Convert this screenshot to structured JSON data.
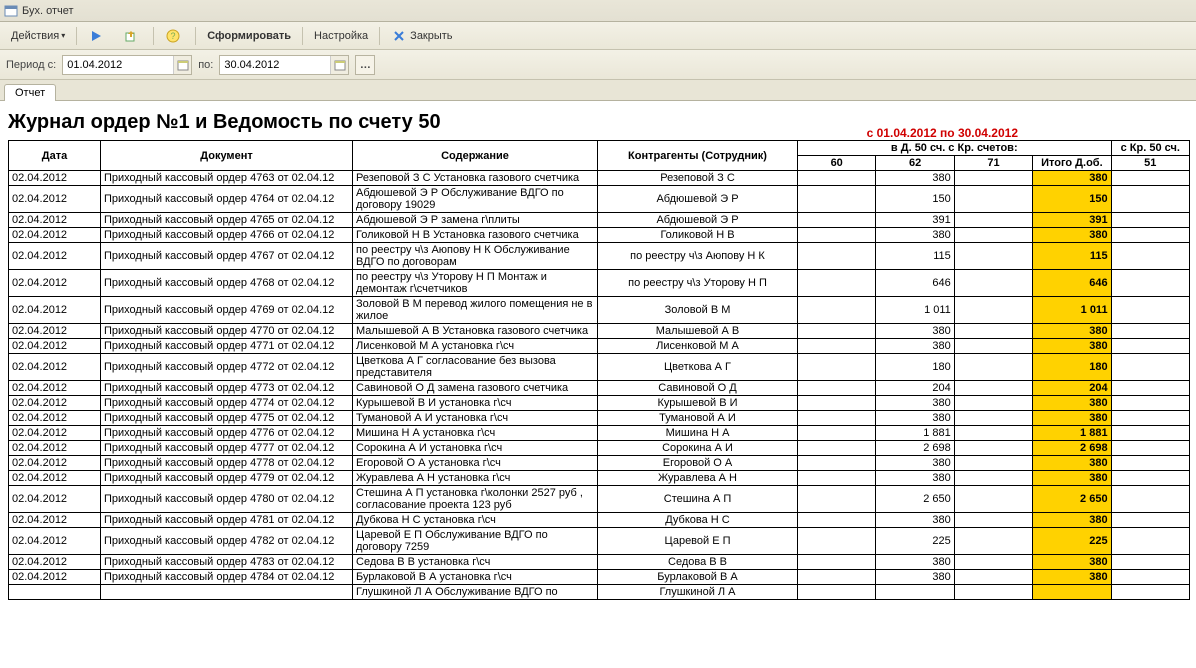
{
  "window": {
    "title": "Бух. отчет"
  },
  "toolbar": {
    "actions": "Действия",
    "form": "Сформировать",
    "settings": "Настройка",
    "close": "Закрыть"
  },
  "period": {
    "label_from": "Период с:",
    "from": "01.04.2012",
    "label_to": "по:",
    "to": "30.04.2012"
  },
  "tab": {
    "name": "Отчет"
  },
  "report": {
    "title": "Журнал ордер №1 и Ведомость по счету 50",
    "period_text": "с 01.04.2012 по 30.04.2012",
    "group_d": "в Д. 50 сч. с Кр. счетов:",
    "group_k": "с Кр. 50 сч.",
    "cols": {
      "date": "Дата",
      "doc": "Документ",
      "desc": "Содержание",
      "contr": "Контрагенты (Сотрудник)",
      "c60": "60",
      "c62": "62",
      "c71": "71",
      "total": "Итого Д.об.",
      "c51": "51"
    }
  },
  "rows": [
    {
      "date": "02.04.2012",
      "doc": "Приходный кассовый ордер 4763 от 02.04.12",
      "desc": "Резеповой З С    Установка газового счетчика",
      "contr": "Резеповой З С",
      "c62": "380",
      "total": "380"
    },
    {
      "date": "02.04.2012",
      "doc": "Приходный кассовый ордер 4764 от 02.04.12",
      "desc": "Абдюшевой  Э Р  Обслуживание ВДГО по договору 19029",
      "contr": "Абдюшевой  Э Р",
      "c62": "150",
      "total": "150"
    },
    {
      "date": "02.04.2012",
      "doc": "Приходный кассовый ордер 4765 от 02.04.12",
      "desc": "Абдюшевой  Э Р      замена г\\плиты",
      "contr": "Абдюшевой  Э Р",
      "c62": "391",
      "total": "391"
    },
    {
      "date": "02.04.2012",
      "doc": "Приходный кассовый ордер 4766 от 02.04.12",
      "desc": "Голиковой Н В     Установка газового счетчика",
      "contr": "Голиковой Н В",
      "c62": "380",
      "total": "380"
    },
    {
      "date": "02.04.2012",
      "doc": "Приходный кассовый ордер 4767 от 02.04.12",
      "desc": "по реестру ч\\з  Аюпову Н К   Обслуживание ВДГО по договорам",
      "contr": "по реестру ч\\з Аюпову Н К",
      "c62": "115",
      "total": "115"
    },
    {
      "date": "02.04.2012",
      "doc": "Приходный кассовый ордер 4768 от 02.04.12",
      "desc": "по реестру ч\\з Уторову Н П  Монтаж и демонтаж г\\счетчиков",
      "contr": "по реестру ч\\з Уторову Н П",
      "c62": "646",
      "total": "646"
    },
    {
      "date": "02.04.2012",
      "doc": "Приходный кассовый ордер 4769 от 02.04.12",
      "desc": "Золовой В М   перевод жилого помещения не в жилое",
      "contr": "Золовой В М",
      "c62": "1 011",
      "total": "1 011"
    },
    {
      "date": "02.04.2012",
      "doc": "Приходный кассовый ордер 4770 от 02.04.12",
      "desc": "Малышевой А В     Установка газового счетчика",
      "contr": "Малышевой А В",
      "c62": "380",
      "total": "380"
    },
    {
      "date": "02.04.2012",
      "doc": "Приходный кассовый ордер 4771 от 02.04.12",
      "desc": "Лисенковой  М А  установка г\\сч",
      "contr": "Лисенковой М А",
      "c62": "380",
      "total": "380"
    },
    {
      "date": "02.04.2012",
      "doc": "Приходный кассовый ордер 4772 от 02.04.12",
      "desc": "Цветкова  А Г   согласование без вызова представителя",
      "contr": "Цветкова  А Г",
      "c62": "180",
      "total": "180"
    },
    {
      "date": "02.04.2012",
      "doc": "Приходный кассовый ордер 4773 от 02.04.12",
      "desc": "Савиновой О Д    замена  газового счетчика",
      "contr": "Савиновой О Д",
      "c62": "204",
      "total": "204"
    },
    {
      "date": "02.04.2012",
      "doc": "Приходный кассовый ордер 4774 от 02.04.12",
      "desc": "Курышевой  В И   установка г\\сч",
      "contr": "Курышевой  В И",
      "c62": "380",
      "total": "380"
    },
    {
      "date": "02.04.2012",
      "doc": "Приходный кассовый ордер 4775 от 02.04.12",
      "desc": "Тумановой А И   установка г\\сч",
      "contr": "Тумановой А И",
      "c62": "380",
      "total": "380"
    },
    {
      "date": "02.04.2012",
      "doc": "Приходный кассовый ордер 4776 от 02.04.12",
      "desc": "Мишина Н А    установка г\\сч",
      "contr": "Мишина Н А",
      "c62": "1 881",
      "total": "1 881"
    },
    {
      "date": "02.04.2012",
      "doc": "Приходный кассовый ордер 4777 от 02.04.12",
      "desc": "Сорокина  А И    установка г\\сч",
      "contr": "Сорокина А И",
      "c62": "2 698",
      "total": "2 698"
    },
    {
      "date": "02.04.2012",
      "doc": "Приходный кассовый ордер 4778 от 02.04.12",
      "desc": "Егоровой О А    установка г\\сч",
      "contr": "Егоровой О А",
      "c62": "380",
      "total": "380"
    },
    {
      "date": "02.04.2012",
      "doc": "Приходный кассовый ордер 4779 от 02.04.12",
      "desc": "Журавлева А Н  установка г\\сч",
      "contr": "Журавлева А Н",
      "c62": "380",
      "total": "380"
    },
    {
      "date": "02.04.2012",
      "doc": "Приходный кассовый ордер 4780 от 02.04.12",
      "desc": "Стешина А П установка г\\колонки  2527 руб , согласование  проекта 123 руб",
      "contr": "Стешина А П",
      "c62": "2 650",
      "total": "2 650"
    },
    {
      "date": "02.04.2012",
      "doc": "Приходный кассовый ордер 4781 от 02.04.12",
      "desc": "Дубкова Н С  установка г\\сч",
      "contr": "Дубкова Н С",
      "c62": "380",
      "total": "380"
    },
    {
      "date": "02.04.2012",
      "doc": "Приходный кассовый ордер 4782 от 02.04.12",
      "desc": "Царевой Е П  Обслуживание ВДГО по договору 7259",
      "contr": "Царевой Е П",
      "c62": "225",
      "total": "225"
    },
    {
      "date": "02.04.2012",
      "doc": "Приходный кассовый ордер 4783 от 02.04.12",
      "desc": "Седова  В В   установка г\\сч",
      "contr": "Седова  В В",
      "c62": "380",
      "total": "380"
    },
    {
      "date": "02.04.2012",
      "doc": "Приходный кассовый ордер 4784 от 02.04.12",
      "desc": "Бурлаковой В А    установка г\\сч",
      "contr": "Бурлаковой В А",
      "c62": "380",
      "total": "380"
    },
    {
      "date": "",
      "doc": "",
      "desc": "Глушкиной Л А  Обслуживание ВДГО по",
      "contr": "Глушкиной Л А",
      "c62": "",
      "total": ""
    }
  ]
}
